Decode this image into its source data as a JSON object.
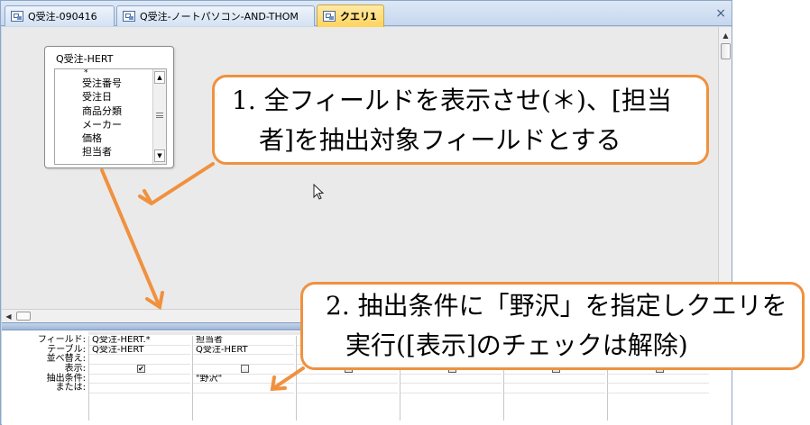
{
  "tabs": [
    {
      "label": "Q受注-090416"
    },
    {
      "label": "Q受注-ノートパソコン-AND-THOM"
    },
    {
      "label": "クエリ1",
      "active": true
    }
  ],
  "close_label": "×",
  "field_list": {
    "title": "Q受注-HERT",
    "items": [
      "*",
      "受注番号",
      "受注日",
      "商品分類",
      "メーカー",
      "価格",
      "担当者"
    ]
  },
  "grid": {
    "row_labels": [
      "フィールド:",
      "テーブル:",
      "並べ替え:",
      "表示:",
      "抽出条件:",
      "または:"
    ],
    "columns": [
      {
        "field": "Q受注-HERT.*",
        "table": "Q受注-HERT",
        "sort": "",
        "show": true,
        "criteria": "",
        "or": ""
      },
      {
        "field": "担当者",
        "table": "Q受注-HERT",
        "sort": "",
        "show": false,
        "criteria": "\"野沢\"",
        "or": ""
      },
      {
        "field": "",
        "table": "",
        "sort": "",
        "show": false,
        "criteria": "",
        "or": ""
      },
      {
        "field": "",
        "table": "",
        "sort": "",
        "show": false,
        "criteria": "",
        "or": ""
      },
      {
        "field": "",
        "table": "",
        "sort": "",
        "show": false,
        "criteria": "",
        "or": ""
      },
      {
        "field": "",
        "table": "",
        "sort": "",
        "show": false,
        "criteria": "",
        "or": ""
      }
    ]
  },
  "callouts": {
    "first": {
      "line1": "1. 全フィールドを表示させ(＊)、[担当",
      "line2": "者]を抽出対象フィールドとする"
    },
    "second": {
      "line1": "2. 抽出条件に「野沢」を指定しクエリを",
      "line2": "実行([表示]のチェックは解除)"
    }
  },
  "colors": {
    "callout_border": "#f0913f",
    "arrow": "#f0913f",
    "active_tab": "#ffd45c"
  }
}
